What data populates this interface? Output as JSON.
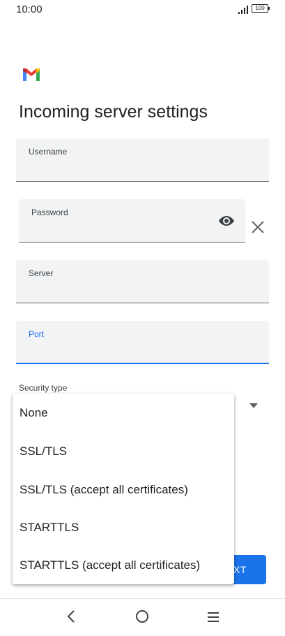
{
  "status_bar": {
    "time": "10:00",
    "battery": "100",
    "icons": [
      "signal-icon",
      "battery-icon"
    ]
  },
  "header": {
    "logo": "gmail-logo",
    "title": "Incoming server settings"
  },
  "form": {
    "username": {
      "label": "Username",
      "value": ""
    },
    "password": {
      "label": "Password",
      "value": "",
      "toggle_icon": "eye-icon"
    },
    "clear_icon": "close-icon",
    "server": {
      "label": "Server",
      "value": ""
    },
    "port": {
      "label": "Port",
      "value": "",
      "focused": true
    },
    "security_type": {
      "label": "Security type",
      "options": [
        "None",
        "SSL/TLS",
        "SSL/TLS (accept all certificates)",
        "STARTTLS",
        "STARTTLS (accept all certificates)"
      ]
    }
  },
  "next_button": {
    "label_visible": "XT"
  },
  "nav_bar": {
    "icons": [
      "back-icon",
      "home-icon",
      "menu-icon"
    ]
  },
  "colors": {
    "accent": "#1a73e8",
    "field_bg": "#f1f3f4",
    "text": "#202124"
  }
}
